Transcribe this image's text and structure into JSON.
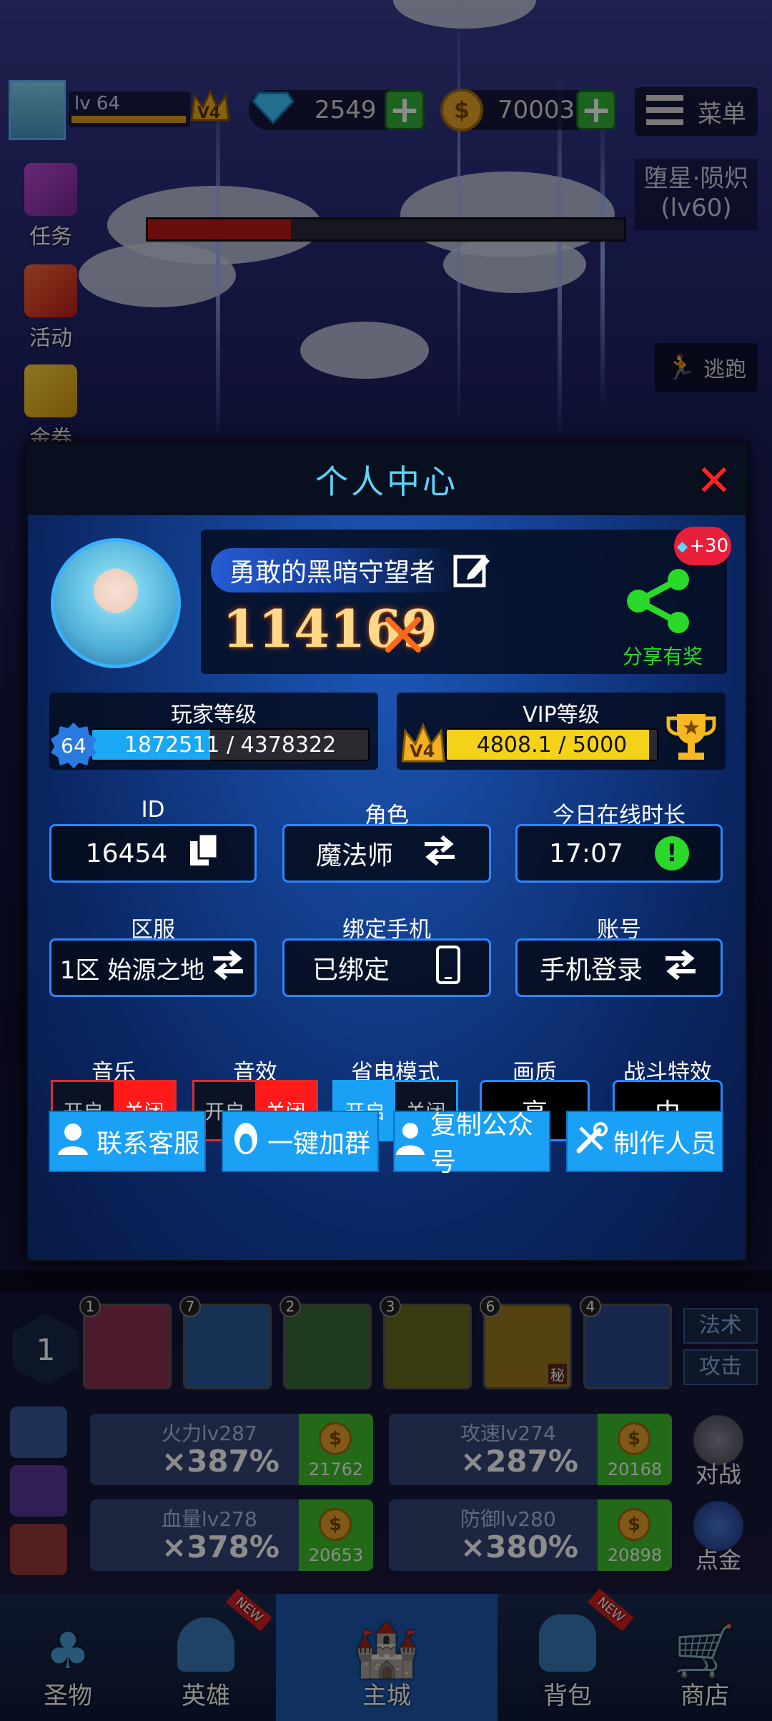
{
  "hud": {
    "level": "lv 64",
    "vip": "V4",
    "diamonds": "2549",
    "gold": "70003",
    "menu": "菜单",
    "boss_name": "堕星·陨炽",
    "boss_level": "(lv60)",
    "escape": "逃跑"
  },
  "side": {
    "task": "任务",
    "activity": "活动",
    "coupon": "金券"
  },
  "modal": {
    "title": "个人中心",
    "player_name": "勇敢的黑暗守望者",
    "power": "114169",
    "share_reward": "+30",
    "share_label": "分享有奖",
    "player_level_label": "玩家等级",
    "player_level": "64",
    "player_exp": "1872511 / 4378322",
    "player_exp_fraction": 0.4277,
    "vip_label": "VIP等级",
    "vip_badge": "V4",
    "vip_exp": "4808.1 / 5000",
    "vip_exp_fraction": 0.9616,
    "id_label": "ID",
    "id_value": "16454",
    "role_label": "角色",
    "role_value": "魔法师",
    "online_label": "今日在线时长",
    "online_value": "17:07",
    "server_label": "区服",
    "server_value": "1区 始源之地",
    "phone_label": "绑定手机",
    "phone_value": "已绑定",
    "account_label": "账号",
    "account_value": "手机登录",
    "music_label": "音乐",
    "sfx_label": "音效",
    "power_save_label": "省电模式",
    "quality_label": "画质",
    "quality_value": "高",
    "fx_label": "战斗特效",
    "fx_value": "中",
    "on": "开启",
    "off": "关闭",
    "btn_service": "联系客服",
    "btn_group": "一键加群",
    "btn_copy": "复制公众号",
    "btn_staff": "制作人员"
  },
  "skills": {
    "level": "1",
    "counts": [
      "1",
      "7",
      "2",
      "3",
      "6",
      "4"
    ],
    "secret": "秘",
    "magic": "法术",
    "attack": "攻击"
  },
  "upgrades": [
    {
      "title": "火力lv287",
      "value": "×387%",
      "cost": "21762"
    },
    {
      "title": "攻速lv274",
      "value": "×287%",
      "cost": "20168"
    },
    {
      "title": "血量lv278",
      "value": "×378%",
      "cost": "20653"
    },
    {
      "title": "防御lv280",
      "value": "×380%",
      "cost": "20898"
    }
  ],
  "right_actions": {
    "battle": "对战",
    "gold": "点金"
  },
  "nav": {
    "relic": "圣物",
    "hero": "英雄",
    "main": "主城",
    "bag": "背包",
    "shop": "商店",
    "new": "NEW"
  },
  "colors": {
    "accent": "#1aa0f5",
    "toggle_off_red": "#ff1a1a",
    "title_blue": "#5fd4ff"
  }
}
